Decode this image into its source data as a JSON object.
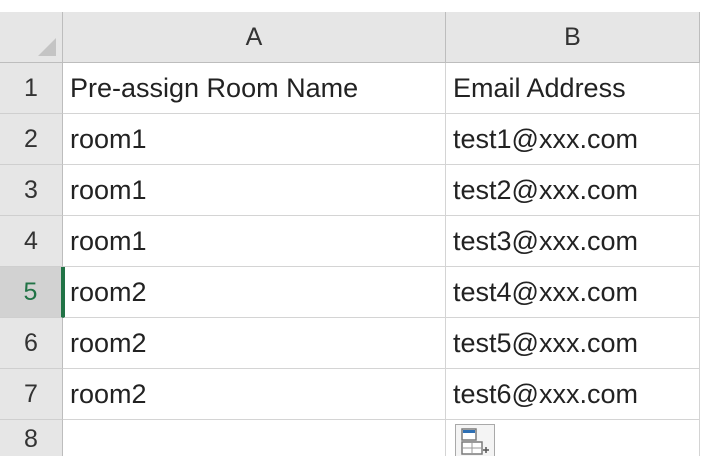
{
  "sheet": {
    "columns": [
      "A",
      "B"
    ],
    "header_row": {
      "row_number": "1",
      "cells": [
        "Pre-assign Room Name",
        "Email Address"
      ]
    },
    "rows": [
      {
        "row_number": "2",
        "room": "room1",
        "email": "test1@xxx.com"
      },
      {
        "row_number": "3",
        "room": "room1",
        "email": "test2@xxx.com"
      },
      {
        "row_number": "4",
        "room": "room1",
        "email": "test3@xxx.com"
      },
      {
        "row_number": "5",
        "room": "room2",
        "email": "test4@xxx.com"
      },
      {
        "row_number": "6",
        "room": "room2",
        "email": "test5@xxx.com"
      },
      {
        "row_number": "7",
        "room": "room2",
        "email": "test6@xxx.com"
      },
      {
        "row_number": "8",
        "room": "",
        "email": ""
      }
    ],
    "active_row": "5",
    "paste_options_icon": "paste-options-icon",
    "colors": {
      "accent": "#217346",
      "header_bg": "#e6e6e6",
      "gridline": "#d4d4d4"
    }
  }
}
